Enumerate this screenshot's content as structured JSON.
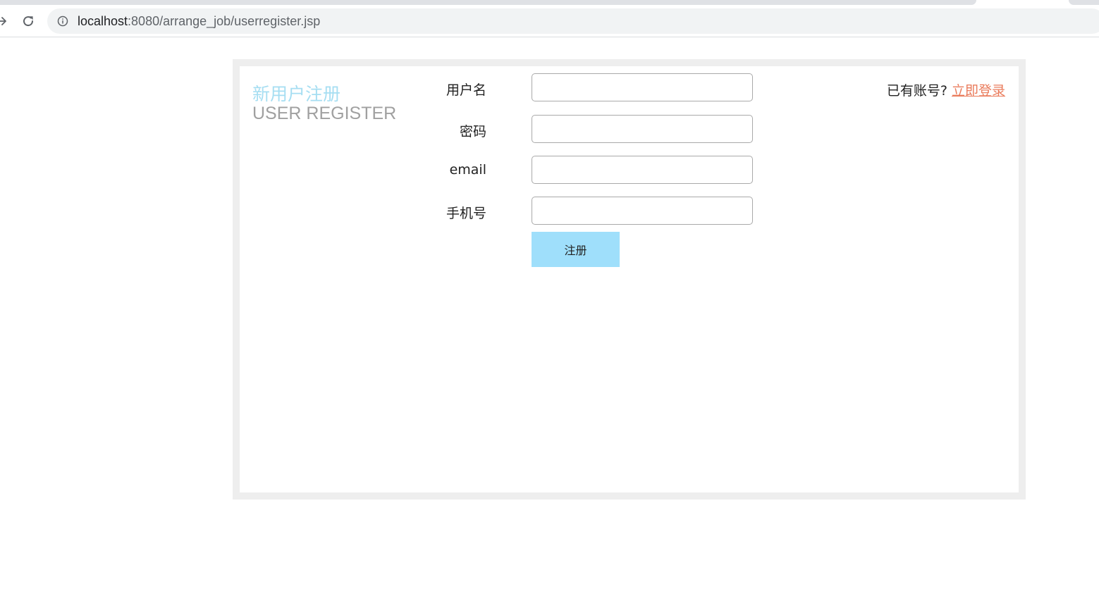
{
  "browser": {
    "url_host": "localhost",
    "url_path": ":8080/arrange_job/userregister.jsp",
    "icons": {
      "back": "arrow-right-icon",
      "reload": "reload-icon",
      "site_info": "info-icon"
    }
  },
  "page": {
    "title_cn": "新用户注册",
    "title_en": "USER REGISTER",
    "form": {
      "fields": [
        {
          "label": "用户名",
          "value": ""
        },
        {
          "label": "密码",
          "value": ""
        },
        {
          "label": "email",
          "value": ""
        },
        {
          "label": "手机号",
          "value": ""
        }
      ],
      "submit_label": "注册"
    },
    "login_prompt": {
      "question": "已有账号?",
      "link_text": "立即登录"
    }
  },
  "colors": {
    "title_cn": "#a6def2",
    "title_en": "#a0a0a0",
    "button_bg": "#9fdffb",
    "link": "#ea7b5b",
    "frame": "#eeeeee"
  }
}
